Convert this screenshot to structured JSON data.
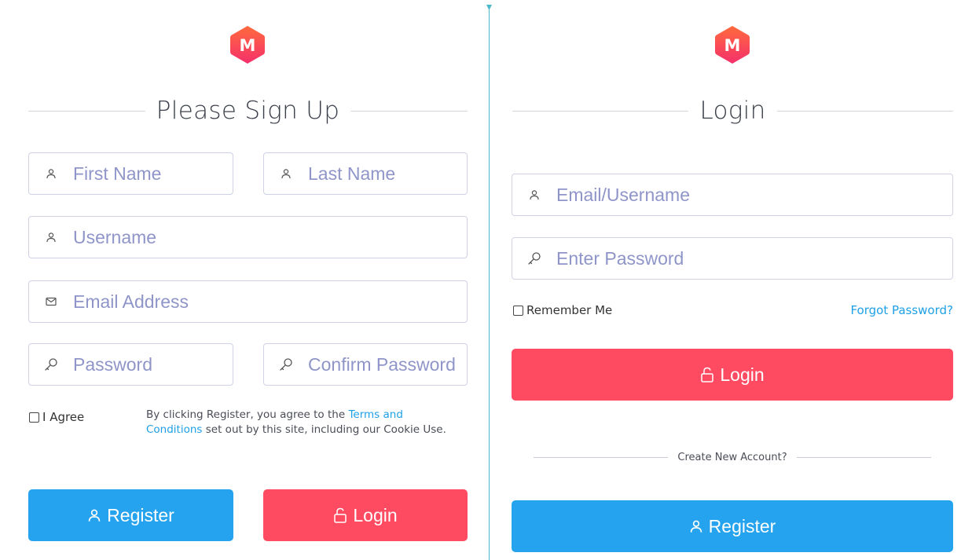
{
  "brand": {
    "logo_letter": "M",
    "logo_color_top": "#ff6a3d",
    "logo_color_bottom": "#f5306b"
  },
  "signup": {
    "title": "Please Sign Up",
    "first_name_placeholder": "First Name",
    "last_name_placeholder": "Last Name",
    "username_placeholder": "Username",
    "email_placeholder": "Email Address",
    "password_placeholder": "Password",
    "confirm_password_placeholder": "Confirm Password",
    "agree_label": "I Agree",
    "terms_prefix": "By clicking Register, you agree to the ",
    "terms_link": "Terms and Conditions",
    "terms_suffix": " set out by this site, including our Cookie Use.",
    "register_label": "Register",
    "login_label": "Login"
  },
  "login": {
    "title": "Login",
    "email_placeholder": "Email/Username",
    "password_placeholder": "Enter Password",
    "remember_label": "Remember Me",
    "forgot_label": "Forgot Password?",
    "login_label": "Login",
    "create_account_label": "Create New Account?",
    "register_label": "Register"
  },
  "colors": {
    "primary_blue": "#25a3ee",
    "danger_red": "#ff4b62",
    "link_blue": "#1ea0e6",
    "placeholder": "#8f95c9",
    "divider": "#4ab9c9"
  },
  "icons": {
    "user": "user-icon",
    "mail": "mail-icon",
    "key": "key-icon",
    "unlock": "unlock-icon"
  }
}
